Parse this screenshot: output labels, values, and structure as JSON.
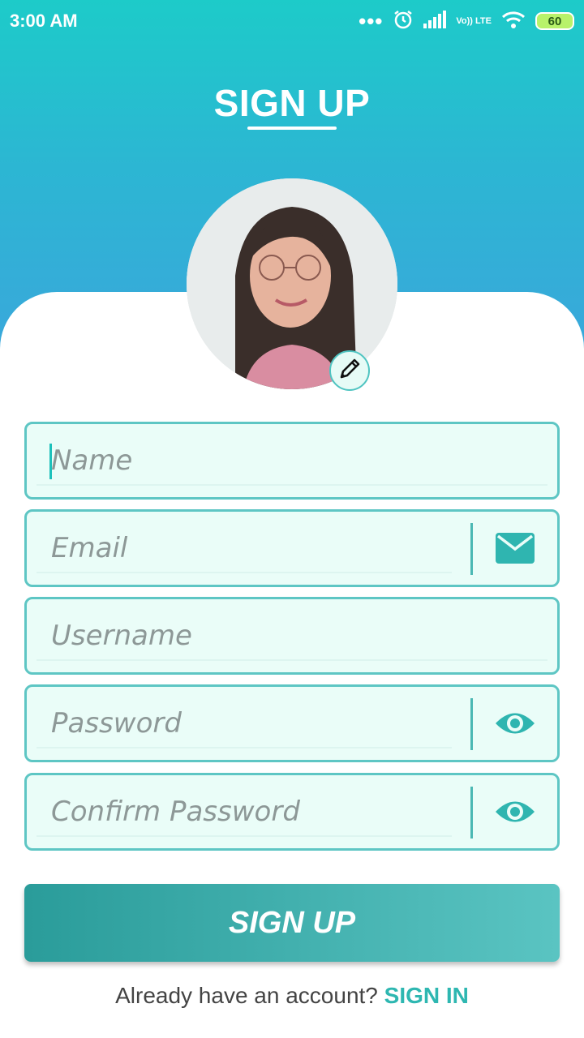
{
  "status_bar": {
    "time": "3:00 AM",
    "dots": "•••",
    "network": "Vo)) LTE",
    "battery": "60",
    "icons": [
      "alarm-icon",
      "signal-icon",
      "volte-icon",
      "wifi-icon",
      "battery-icon"
    ]
  },
  "page": {
    "title": "SIGN UP"
  },
  "avatar": {
    "icon": "profile-photo",
    "edit_icon": "pencil-icon"
  },
  "form": {
    "name_placeholder": "Name",
    "email_placeholder": "Email",
    "username_placeholder": "Username",
    "password_placeholder": "Password",
    "confirm_password_placeholder": "Confirm Password",
    "email_icon": "envelope-icon",
    "password_icon": "eye-icon",
    "confirm_password_icon": "eye-icon"
  },
  "actions": {
    "signup_label": "SIGN UP",
    "have_account_text": "Already have an account?",
    "signin_label": "SIGN IN"
  },
  "colors": {
    "accent": "#2eb7b1",
    "header_top": "#1dcbc9",
    "header_bottom": "#3ba6dc",
    "field_border": "#5ec6c4",
    "field_bg": "#eafdf8"
  }
}
